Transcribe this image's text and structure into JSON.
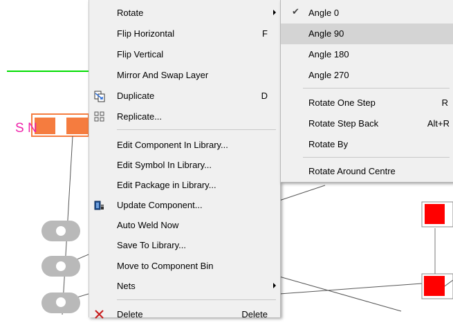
{
  "canvas": {
    "component_label": "S N",
    "colors": {
      "green_wire": "#00dd00",
      "magenta_text": "#ee22aa",
      "orange_pad": "#f57c3f",
      "red_pad": "#ff0000",
      "grey_pad": "#b9b9b9"
    }
  },
  "main_menu": {
    "items": [
      {
        "label": "Rotate",
        "shortcut": "",
        "submenu": true,
        "icon": ""
      },
      {
        "label": "Flip Horizontal",
        "shortcut": "F",
        "submenu": false,
        "icon": ""
      },
      {
        "label": "Flip Vertical",
        "shortcut": "",
        "submenu": false,
        "icon": ""
      },
      {
        "label": "Mirror And Swap Layer",
        "shortcut": "",
        "submenu": false,
        "icon": ""
      },
      {
        "label": "Duplicate",
        "shortcut": "D",
        "submenu": false,
        "icon": "duplicate-icon"
      },
      {
        "label": "Replicate...",
        "shortcut": "",
        "submenu": false,
        "icon": "replicate-icon"
      },
      {
        "label": "Edit Component In Library...",
        "shortcut": "",
        "submenu": false,
        "icon": ""
      },
      {
        "label": "Edit Symbol In Library...",
        "shortcut": "",
        "submenu": false,
        "icon": ""
      },
      {
        "label": "Edit Package in Library...",
        "shortcut": "",
        "submenu": false,
        "icon": ""
      },
      {
        "label": "Update Component...",
        "shortcut": "",
        "submenu": false,
        "icon": "update-component-icon"
      },
      {
        "label": "Auto Weld Now",
        "shortcut": "",
        "submenu": false,
        "icon": ""
      },
      {
        "label": "Save To Library...",
        "shortcut": "",
        "submenu": false,
        "icon": ""
      },
      {
        "label": "Move to Component Bin",
        "shortcut": "",
        "submenu": false,
        "icon": ""
      },
      {
        "label": "Nets",
        "shortcut": "",
        "submenu": true,
        "icon": ""
      },
      {
        "label": "Delete",
        "shortcut": "Delete",
        "submenu": false,
        "icon": "delete-icon"
      }
    ]
  },
  "sub_menu": {
    "items": [
      {
        "label": "Angle 0",
        "shortcut": "",
        "checked": true,
        "highlighted": false
      },
      {
        "label": "Angle 90",
        "shortcut": "",
        "checked": false,
        "highlighted": true
      },
      {
        "label": "Angle 180",
        "shortcut": "",
        "checked": false,
        "highlighted": false
      },
      {
        "label": "Angle 270",
        "shortcut": "",
        "checked": false,
        "highlighted": false
      },
      {
        "label": "Rotate One Step",
        "shortcut": "R",
        "checked": false,
        "highlighted": false
      },
      {
        "label": "Rotate Step Back",
        "shortcut": "Alt+R",
        "checked": false,
        "highlighted": false
      },
      {
        "label": "Rotate By",
        "shortcut": "",
        "checked": false,
        "highlighted": false
      },
      {
        "label": "Rotate Around Centre",
        "shortcut": "",
        "checked": false,
        "highlighted": false
      }
    ],
    "check_glyph": "✔"
  }
}
